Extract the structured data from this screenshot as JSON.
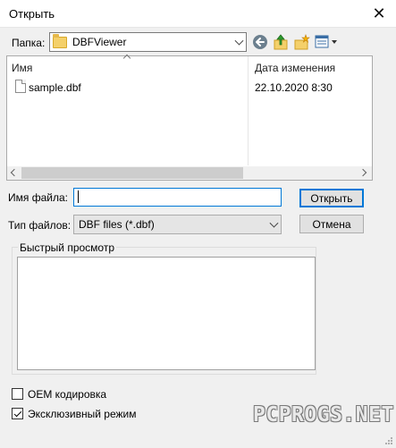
{
  "window": {
    "title": "Открыть",
    "close_icon": "close-icon"
  },
  "location": {
    "label": "Папка:",
    "current_folder": "DBFViewer",
    "icons": [
      "back-icon",
      "up-folder-icon",
      "new-folder-icon",
      "view-menu-icon"
    ]
  },
  "file_list": {
    "columns": {
      "name": "Имя",
      "date": "Дата изменения"
    },
    "sort_indicator": "sort-ascending-icon",
    "items": [
      {
        "name": "sample.dbf",
        "modified": "22.10.2020 8:30",
        "icon": "file-icon"
      }
    ]
  },
  "filename": {
    "label": "Имя файла:",
    "value": ""
  },
  "filetype": {
    "label": "Тип файлов:",
    "value": "DBF files (*.dbf)"
  },
  "buttons": {
    "open": "Открыть",
    "cancel": "Отмена"
  },
  "preview": {
    "title": "Быстрый просмотр"
  },
  "options": [
    {
      "label": "OEM кодировка",
      "checked": false
    },
    {
      "label": "Эксклюзивный режим",
      "checked": true
    }
  ],
  "watermark": "PCPROGS.NET",
  "colors": {
    "accent": "#0078d7",
    "folder": "#f4d06a",
    "dialog_bg": "#f0f0f0"
  }
}
